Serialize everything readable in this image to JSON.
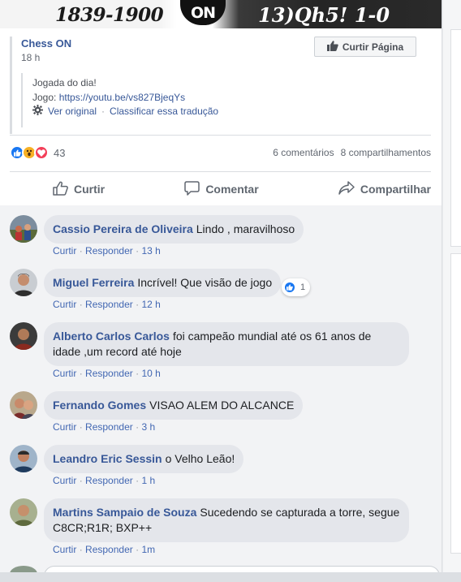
{
  "banner": {
    "years": "1839-1900",
    "logo_text": "ON",
    "move": "13)Qh5!  1-0"
  },
  "post": {
    "page_name": "Chess ON",
    "time": "18 h",
    "like_page_label": "Curtir Página",
    "text_line1": "Jogada do dia!",
    "text_line2_prefix": "Jogo: ",
    "link": "https://youtu.be/vs827BjeqYs",
    "see_original": "Ver original",
    "rate_translation": "Classificar essa tradução",
    "reaction_count": "43",
    "comments_count": "6 comentários",
    "shares_count": "8 compartilhamentos"
  },
  "actions": {
    "like": "Curtir",
    "comment": "Comentar",
    "share": "Compartilhar"
  },
  "comments": [
    {
      "author": "Cassio Pereira de Oliveira",
      "text": "Lindo , maravilhoso",
      "like": "Curtir",
      "reply": "Responder",
      "time": "13 h"
    },
    {
      "author": "Miguel Ferreira",
      "text": "Incrível! Que visão de jogo",
      "like": "Curtir",
      "reply": "Responder",
      "time": "12 h",
      "likes": "1"
    },
    {
      "author": "Alberto Carlos Carlos",
      "text": "foi campeão mundial até os 61 anos de idade ,um record até hoje",
      "like": "Curtir",
      "reply": "Responder",
      "time": "10 h"
    },
    {
      "author": "Fernando Gomes",
      "text": "VISAO ALEM DO ALCANCE",
      "like": "Curtir",
      "reply": "Responder",
      "time": "3 h"
    },
    {
      "author": "Leandro Eric Sessin",
      "text": "o Velho Leão!",
      "like": "Curtir",
      "reply": "Responder",
      "time": "1 h"
    },
    {
      "author": "Martins Sampaio de Souza",
      "text": "Sucedendo se capturada a torre, segue C8CR;R1R; BXP++",
      "like": "Curtir",
      "reply": "Responder",
      "time": "1m"
    }
  ],
  "separator": "·",
  "colors": {
    "link_blue": "#385898",
    "fb_blue": "#4267b2",
    "bubble_gray": "#e4e6eb",
    "like_blue": "#1877f2",
    "love_red": "#f33e58",
    "wow_yellow": "#f7b125"
  }
}
